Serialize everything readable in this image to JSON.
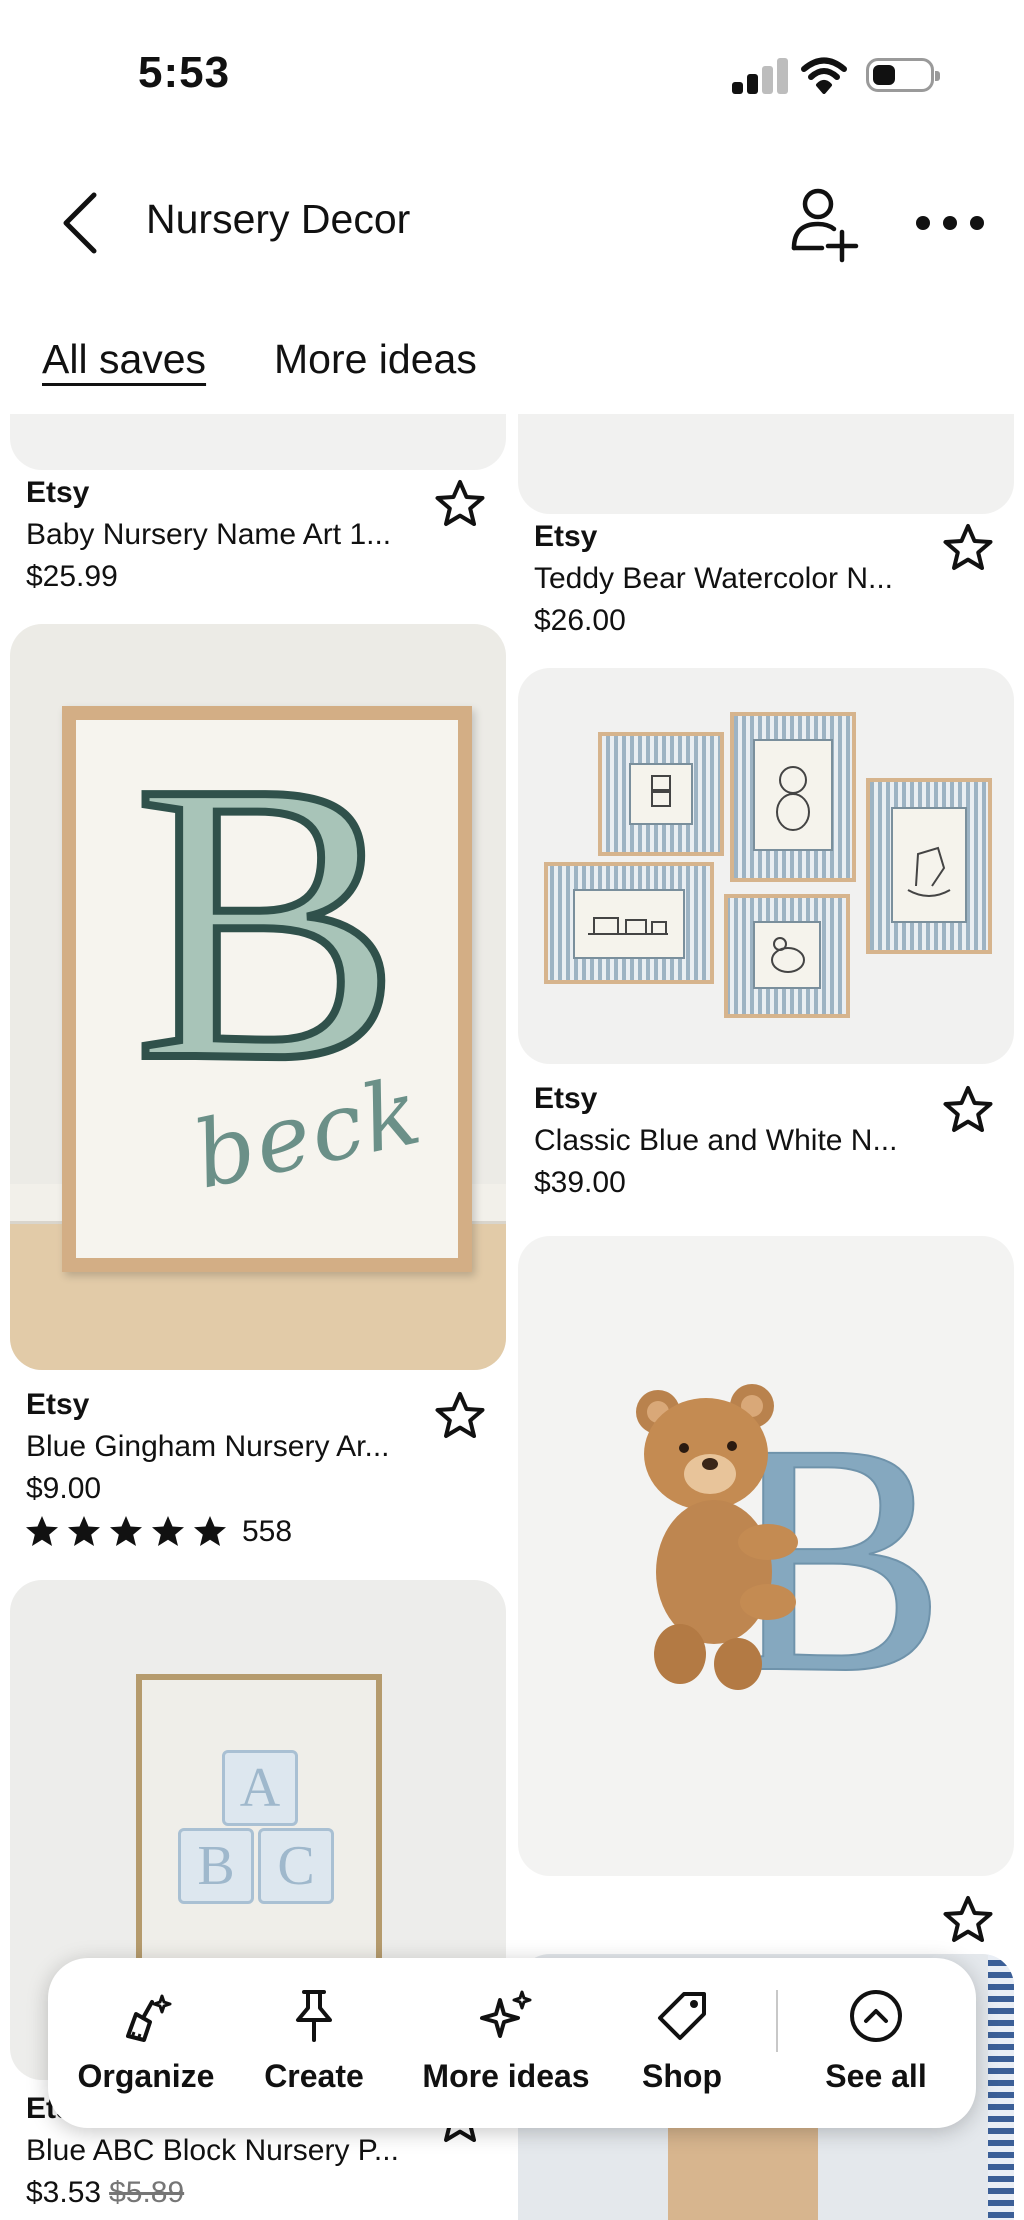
{
  "status_bar": {
    "time": "5:53"
  },
  "header": {
    "title": "Nursery Decor",
    "tabs": [
      {
        "label": "All saves",
        "active": true
      },
      {
        "label": "More ideas",
        "active": false
      }
    ]
  },
  "pins": [
    {
      "source": "Etsy",
      "title": "Baby Nursery Name Art 1...",
      "price": "$25.99"
    },
    {
      "source": "Etsy",
      "title": "Teddy Bear Watercolor N...",
      "price": "$26.00"
    },
    {
      "source": "Etsy",
      "title": "Blue Gingham Nursery Ar...",
      "price": "$9.00",
      "rating": 5,
      "review_count": "558",
      "art_letter": "B",
      "art_script": "beck"
    },
    {
      "source": "Etsy",
      "title": "Classic Blue and White N...",
      "price": "$39.00"
    },
    {
      "art_letter": "B"
    },
    {
      "source": "Etsy",
      "title": "Blue ABC Block Nursery P...",
      "price": "$3.53",
      "original_price": "$5.89",
      "art_letters": [
        "A",
        "B",
        "C"
      ]
    }
  ],
  "toolbar": {
    "items": [
      {
        "label": "Organize",
        "icon": "broom-sparkle-icon"
      },
      {
        "label": "Create",
        "icon": "pushpin-icon"
      },
      {
        "label": "More ideas",
        "icon": "sparkles-icon"
      },
      {
        "label": "Shop",
        "icon": "price-tag-icon"
      },
      {
        "label": "See all",
        "icon": "chevron-up-circle-icon"
      }
    ]
  },
  "colors": {
    "text": "#111111",
    "card_bg": "#f1f1f0",
    "gingham_green": "#9fbcb0",
    "frame_wood": "#d3ae85",
    "dusty_blue": "#7fa3bb",
    "strike_gray": "#767676"
  }
}
